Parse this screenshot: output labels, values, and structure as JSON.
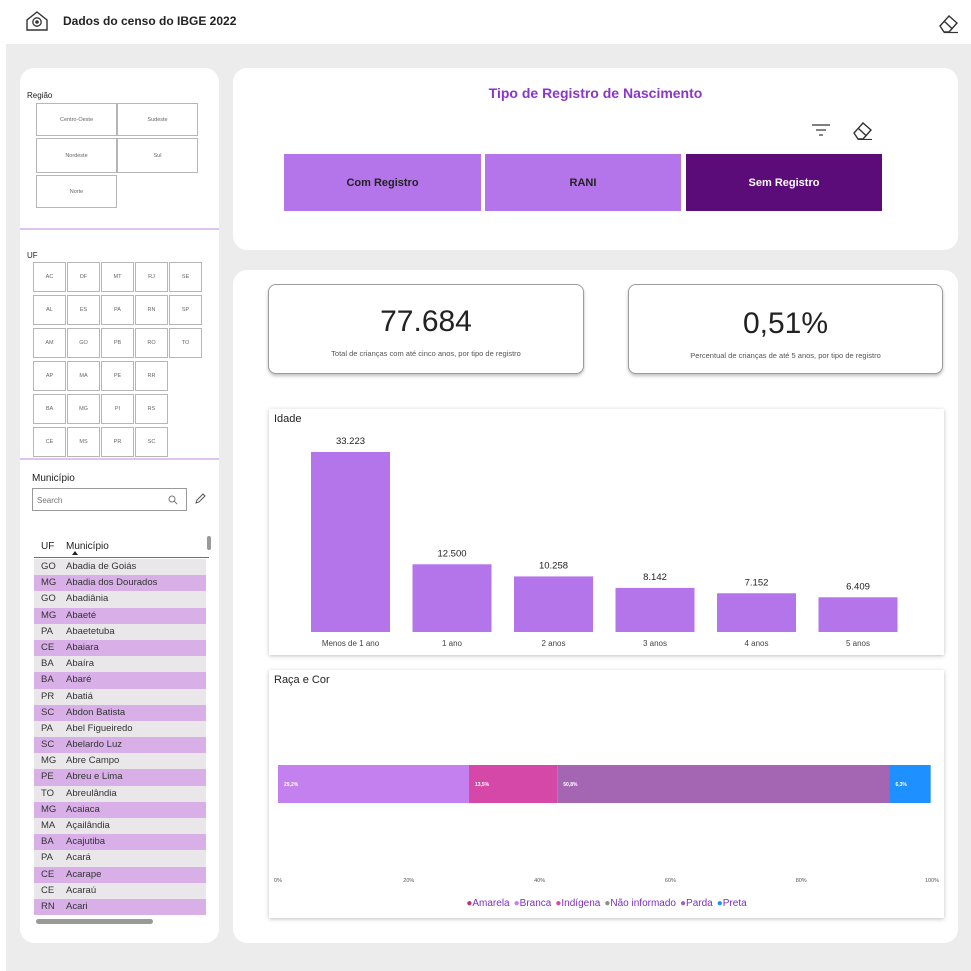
{
  "app": {
    "title": "Dados do censo do IBGE 2022",
    "icon": "location-home-icon"
  },
  "filters": {
    "regiao": {
      "label": "Região",
      "options": [
        "Centro-Oeste",
        "Sudeste",
        "Nordeste",
        "Sul",
        "Norte"
      ]
    },
    "uf": {
      "label": "UF",
      "options": [
        "AC",
        "DF",
        "MT",
        "RJ",
        "SE",
        "AL",
        "ES",
        "PA",
        "RN",
        "SP",
        "AM",
        "GO",
        "PB",
        "RO",
        "TO",
        "AP",
        "MA",
        "PE",
        "RR",
        "BA",
        "MG",
        "PI",
        "RS",
        "CE",
        "MS",
        "PR",
        "SC"
      ]
    },
    "municipio": {
      "label": "Município",
      "placeholder": "Search"
    }
  },
  "table": {
    "columns": [
      "UF",
      "Município"
    ],
    "rows": [
      [
        "GO",
        "Abadia de Goiás"
      ],
      [
        "MG",
        "Abadia dos Dourados"
      ],
      [
        "GO",
        "Abadiânia"
      ],
      [
        "MG",
        "Abaeté"
      ],
      [
        "PA",
        "Abaetetuba"
      ],
      [
        "CE",
        "Abaiara"
      ],
      [
        "BA",
        "Abaíra"
      ],
      [
        "BA",
        "Abaré"
      ],
      [
        "PR",
        "Abatiá"
      ],
      [
        "SC",
        "Abdon Batista"
      ],
      [
        "PA",
        "Abel Figueiredo"
      ],
      [
        "SC",
        "Abelardo Luz"
      ],
      [
        "MG",
        "Abre Campo"
      ],
      [
        "PE",
        "Abreu e Lima"
      ],
      [
        "TO",
        "Abreulândia"
      ],
      [
        "MG",
        "Acaiaca"
      ],
      [
        "MA",
        "Açailândia"
      ],
      [
        "BA",
        "Acajutiba"
      ],
      [
        "PA",
        "Acará"
      ],
      [
        "CE",
        "Acarape"
      ],
      [
        "CE",
        "Acaraú"
      ],
      [
        "RN",
        "Acari"
      ]
    ],
    "row_colors": {
      "odd": "#e9e7ea",
      "even": "#d8b0e7"
    }
  },
  "registro": {
    "title": "Tipo de Registro de Nascimento",
    "buttons": [
      "Com Registro",
      "RANI",
      "Sem Registro"
    ],
    "selected": "Sem Registro"
  },
  "cards": [
    {
      "value": "77.684",
      "label": "Total de crianças com até cinco anos, por tipo de registro"
    },
    {
      "value": "0,51%",
      "label": "Percentual de crianças de até 5 anos, por tipo de registro"
    }
  ],
  "colors": {
    "accent": "#8b35c9",
    "selected": "#5c0c78",
    "bar": "#b575ea"
  },
  "chart_data": [
    {
      "type": "bar",
      "title": "Idade",
      "categories": [
        "Menos de 1 ano",
        "1 ano",
        "2 anos",
        "3 anos",
        "4 anos",
        "5 anos"
      ],
      "values": [
        33223,
        12500,
        10258,
        8142,
        7152,
        6409
      ],
      "value_labels": [
        "33.223",
        "12.500",
        "10.258",
        "8.142",
        "7.152",
        "6.409"
      ],
      "color": "#b575ea"
    },
    {
      "type": "bar",
      "orientation": "horizontal-100%-stacked",
      "title": "Raça e Cor",
      "xticks": [
        "0%",
        "20%",
        "40%",
        "60%",
        "80%",
        "100%"
      ],
      "series": [
        {
          "name": "Amarela",
          "value": 0,
          "color": "#c0307e"
        },
        {
          "name": "Branca",
          "value": 29.2,
          "label": "29,2%",
          "color": "#c580f0"
        },
        {
          "name": "Indígena",
          "value": 13.5,
          "label": "13,5%",
          "color": "#d548a8"
        },
        {
          "name": "Não informado",
          "value": 0,
          "color": "#8e8e8e"
        },
        {
          "name": "Parda",
          "value": 50.8,
          "label": "50,8%",
          "color": "#a466b3"
        },
        {
          "name": "Preta",
          "value": 6.3,
          "label": "6,3%",
          "color": "#1e90ff"
        }
      ]
    }
  ]
}
